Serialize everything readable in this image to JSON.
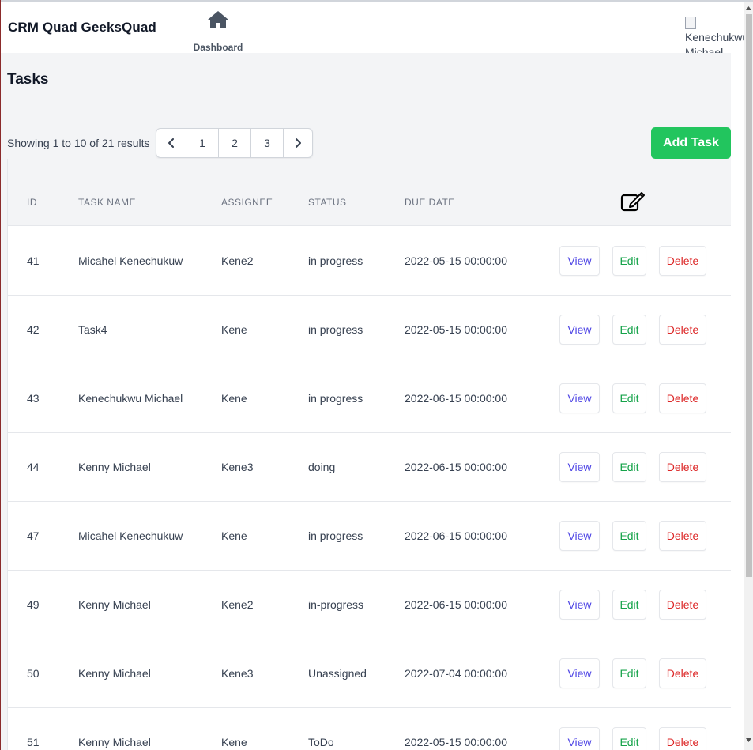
{
  "header": {
    "brand": "CRM Quad GeeksQuad",
    "nav": {
      "dashboard_label": "Dashboard",
      "dashboard_icon": "home-icon"
    },
    "user": {
      "avatar_alt_line1": "Kenechukwu",
      "avatar_alt_line2": "Michael"
    }
  },
  "page": {
    "title": "Tasks",
    "results_text": "Showing 1 to 10 of 21 results",
    "add_task_label": "Add Task"
  },
  "pagination": {
    "prev_icon": "chevron-left-icon",
    "next_icon": "chevron-right-icon",
    "pages": [
      "1",
      "2",
      "3"
    ]
  },
  "table": {
    "headers": {
      "id": "ID",
      "name": "TASK NAME",
      "assignee": "ASSIGNEE",
      "status": "STATUS",
      "due": "DUE DATE",
      "actions_icon": "edit-icon"
    },
    "actions": {
      "view": "View",
      "edit": "Edit",
      "delete": "Delete"
    },
    "rows": [
      {
        "id": "41",
        "name": "Micahel Kenechukuw",
        "assignee": "Kene2",
        "status": "in progress",
        "due": "2022-05-15 00:00:00"
      },
      {
        "id": "42",
        "name": "Task4",
        "assignee": "Kene",
        "status": "in progress",
        "due": "2022-05-15 00:00:00"
      },
      {
        "id": "43",
        "name": "Kenechukwu Michael",
        "assignee": "Kene",
        "status": "in progress",
        "due": "2022-06-15 00:00:00"
      },
      {
        "id": "44",
        "name": "Kenny Michael",
        "assignee": "Kene3",
        "status": "doing",
        "due": "2022-06-15 00:00:00"
      },
      {
        "id": "47",
        "name": "Micahel Kenechukuw",
        "assignee": "Kene",
        "status": "in progress",
        "due": "2022-06-15 00:00:00"
      },
      {
        "id": "49",
        "name": "Kenny Michael",
        "assignee": "Kene2",
        "status": "in-progress",
        "due": "2022-06-15 00:00:00"
      },
      {
        "id": "50",
        "name": "Kenny Michael",
        "assignee": "Kene3",
        "status": "Unassigned",
        "due": "2022-07-04 00:00:00"
      },
      {
        "id": "51",
        "name": "Kenny Michael",
        "assignee": "Kene",
        "status": "ToDo",
        "due": "2022-05-15 00:00:00"
      }
    ]
  },
  "colors": {
    "add_task_bg": "#22c55e",
    "view_text": "#4f46e5",
    "edit_text": "#16a34a",
    "delete_text": "#dc2626",
    "page_bg": "#f3f4f6"
  }
}
